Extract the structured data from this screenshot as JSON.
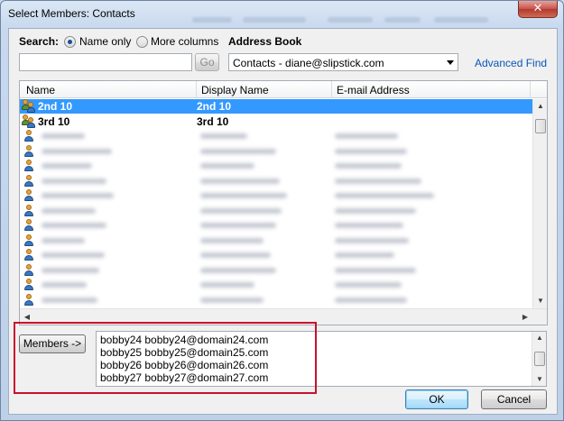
{
  "window": {
    "title": "Select Members: Contacts",
    "close_glyph": "✕"
  },
  "search": {
    "label": "Search:",
    "option_name_only": "Name only",
    "option_more_columns": "More columns",
    "selected_option": "Name only",
    "input_value": "",
    "go_label": "Go"
  },
  "address_book": {
    "label": "Address Book",
    "selected": "Contacts - diane@slipstick.com",
    "advanced_find": "Advanced Find"
  },
  "list": {
    "columns": [
      "Name",
      "Display Name",
      "E-mail Address"
    ],
    "rows": [
      {
        "type": "group",
        "icon": "group-icon",
        "name": "2nd 10",
        "display": "2nd 10",
        "email": "",
        "selected": true
      },
      {
        "type": "group",
        "icon": "group-icon",
        "name": "3rd 10",
        "display": "3rd 10",
        "email": "",
        "selected": false
      },
      {
        "type": "contact",
        "icon": "person-icon",
        "name": "",
        "display": "",
        "email": "",
        "selected": false
      },
      {
        "type": "contact",
        "icon": "person-icon",
        "name": "",
        "display": "",
        "email": "",
        "selected": false
      },
      {
        "type": "contact",
        "icon": "person-icon",
        "name": "",
        "display": "",
        "email": "",
        "selected": false
      },
      {
        "type": "contact",
        "icon": "person-icon",
        "name": "",
        "display": "",
        "email": "",
        "selected": false
      },
      {
        "type": "contact",
        "icon": "person-icon",
        "name": "",
        "display": "",
        "email": "",
        "selected": false
      },
      {
        "type": "contact",
        "icon": "person-icon",
        "name": "",
        "display": "",
        "email": "",
        "selected": false
      },
      {
        "type": "contact",
        "icon": "person-icon",
        "name": "",
        "display": "",
        "email": "",
        "selected": false
      },
      {
        "type": "contact",
        "icon": "person-icon",
        "name": "",
        "display": "",
        "email": "",
        "selected": false
      },
      {
        "type": "contact",
        "icon": "person-icon",
        "name": "",
        "display": "",
        "email": "",
        "selected": false
      },
      {
        "type": "contact",
        "icon": "person-icon",
        "name": "",
        "display": "",
        "email": "",
        "selected": false
      },
      {
        "type": "contact",
        "icon": "person-icon",
        "name": "",
        "display": "",
        "email": "",
        "selected": false
      },
      {
        "type": "contact",
        "icon": "person-icon",
        "name": "",
        "display": "",
        "email": "",
        "selected": false
      },
      {
        "type": "contact",
        "icon": "person-icon",
        "name": "",
        "display": "",
        "email": "",
        "selected": false
      }
    ]
  },
  "members": {
    "button_label": "Members ->",
    "entries": [
      "bobby24  bobby24@domain24.com",
      "bobby25  bobby25@domain25.com",
      "bobby26  bobby26@domain26.com",
      "bobby27  bobby27@domain27.com"
    ]
  },
  "footer": {
    "ok_label": "OK",
    "cancel_label": "Cancel"
  },
  "colors": {
    "selection": "#3399ff",
    "highlight_frame": "#c8102e",
    "link": "#0b55b6"
  }
}
